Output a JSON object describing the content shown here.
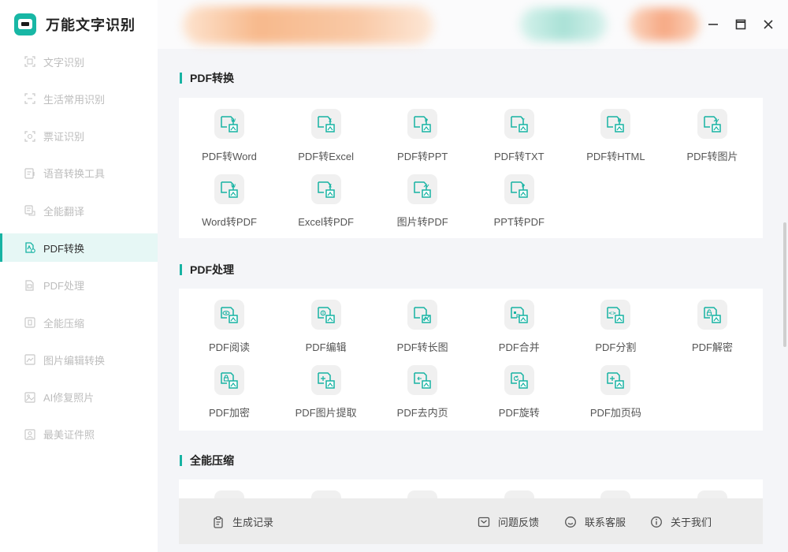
{
  "app": {
    "title": "万能文字识别"
  },
  "sidebar": {
    "items": [
      {
        "label": "文字识别",
        "icon": "scan-text-icon",
        "active": false
      },
      {
        "label": "生活常用识别",
        "icon": "scan-life-icon",
        "active": false
      },
      {
        "label": "票证识别",
        "icon": "scan-ticket-icon",
        "active": false
      },
      {
        "label": "语音转换工具",
        "icon": "voice-convert-icon",
        "active": false
      },
      {
        "label": "全能翻译",
        "icon": "translate-icon",
        "active": false
      },
      {
        "label": "PDF转换",
        "icon": "pdf-convert-icon",
        "active": true
      },
      {
        "label": "PDF处理",
        "icon": "pdf-process-icon",
        "active": false
      },
      {
        "label": "全能压缩",
        "icon": "compress-icon",
        "active": false
      },
      {
        "label": "图片编辑转换",
        "icon": "image-edit-icon",
        "active": false
      },
      {
        "label": "AI修复照片",
        "icon": "ai-photo-icon",
        "active": false
      },
      {
        "label": "最美证件照",
        "icon": "id-photo-icon",
        "active": false
      }
    ]
  },
  "window": {
    "controls": [
      "minimize-icon",
      "maximize-icon",
      "close-icon"
    ]
  },
  "colors": {
    "accent": "#17b3a3",
    "active_bg": "#e6f7f5",
    "icon_bg": "#f0f0f0"
  },
  "sections": {
    "pdf_convert": {
      "title": "PDF转换",
      "tools": [
        {
          "label": "PDF转Word",
          "glyph": "W"
        },
        {
          "label": "PDF转Excel",
          "glyph": "X"
        },
        {
          "label": "PDF转PPT",
          "glyph": "P"
        },
        {
          "label": "PDF转TXT",
          "glyph": "T"
        },
        {
          "label": "PDF转HTML",
          "glyph": "H"
        },
        {
          "label": "PDF转图片",
          "glyph": "img"
        },
        {
          "label": "Word转PDF",
          "glyph": "W"
        },
        {
          "label": "Excel转PDF",
          "glyph": "X"
        },
        {
          "label": "图片转PDF",
          "glyph": "img"
        },
        {
          "label": "PPT转PDF",
          "glyph": "P"
        }
      ]
    },
    "pdf_process": {
      "title": "PDF处理",
      "tools": [
        {
          "label": "PDF阅读",
          "glyph": "eye"
        },
        {
          "label": "PDF编辑",
          "glyph": "edit"
        },
        {
          "label": "PDF转长图",
          "glyph": "long"
        },
        {
          "label": "PDF合并",
          "glyph": "merge"
        },
        {
          "label": "PDF分割",
          "glyph": "split"
        },
        {
          "label": "PDF解密",
          "glyph": "unlock"
        },
        {
          "label": "PDF加密",
          "glyph": "lock"
        },
        {
          "label": "PDF图片提取",
          "glyph": "extract"
        },
        {
          "label": "PDF去内页",
          "glyph": "remove"
        },
        {
          "label": "PDF旋转",
          "glyph": "rotate"
        },
        {
          "label": "PDF加页码",
          "glyph": "pagenum"
        }
      ]
    },
    "compress": {
      "title": "全能压缩"
    }
  },
  "bottombar": {
    "history": "生成记录",
    "feedback": "问题反馈",
    "support": "联系客服",
    "about": "关于我们"
  }
}
